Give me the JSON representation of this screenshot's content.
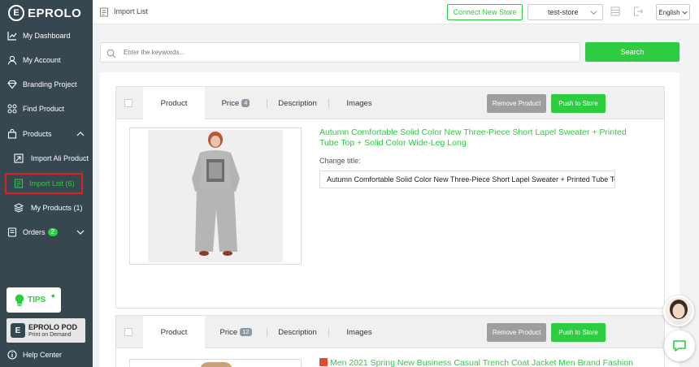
{
  "brand": {
    "name": "EPROLO",
    "mark": "E"
  },
  "sidebar": {
    "items": [
      {
        "label": "My Dashboard",
        "icon": "chart-icon"
      },
      {
        "label": "My Account",
        "icon": "user-icon"
      },
      {
        "label": "Branding Project",
        "icon": "diamond-icon"
      },
      {
        "label": "Find Product",
        "icon": "grid-icon"
      },
      {
        "label": "Products",
        "icon": "bag-icon"
      },
      {
        "label": "Import Ali Product",
        "icon": "import-icon"
      },
      {
        "label": "Import List (6)",
        "icon": "list-icon"
      },
      {
        "label": "My Products (1)",
        "icon": "layers-icon"
      },
      {
        "label": "Orders",
        "icon": "document-icon",
        "badge": "2"
      }
    ],
    "tips_label": "TIPS",
    "pod_title": "EPROLO POD",
    "pod_subtitle": "Print on Demand",
    "help_label": "Help Center"
  },
  "header": {
    "page_title": "Import List",
    "connect_label": "Connect New Store",
    "store_value": "test-store",
    "language": "English"
  },
  "search": {
    "placeholder": "Enter the keywords...",
    "button_label": "Search"
  },
  "cards": [
    {
      "tabs": {
        "product": "Product",
        "price": "Price",
        "price_count": "4",
        "description": "Description",
        "images": "Images"
      },
      "remove_label": "Remove Product",
      "push_label": "Push to Store",
      "title": "Autumn Comfortable Solid Color New Three-Piece Short Lapel Sweater + Printed Tube Top + Solid Color Wide-Leg Long",
      "change_title_label": "Change title:",
      "title_input_value": "Autumn Comfortable Solid Color New Three-Piece Short Lapel Sweater + Printed Tube Top + Solid Color Wide-Leg Long"
    },
    {
      "tabs": {
        "product": "Product",
        "price": "Price",
        "price_count": "12",
        "description": "Description",
        "images": "Images"
      },
      "remove_label": "Remove Product",
      "push_label": "Push to Store",
      "title": "Men 2021 Spring New Business Casual Trench Coat Jacket Men Brand Fashion"
    }
  ],
  "colors": {
    "sidebar_bg": "#37474f",
    "accent": "#2ecc40",
    "highlight_border": "#e02020",
    "gray_button": "#9e9e9e"
  }
}
